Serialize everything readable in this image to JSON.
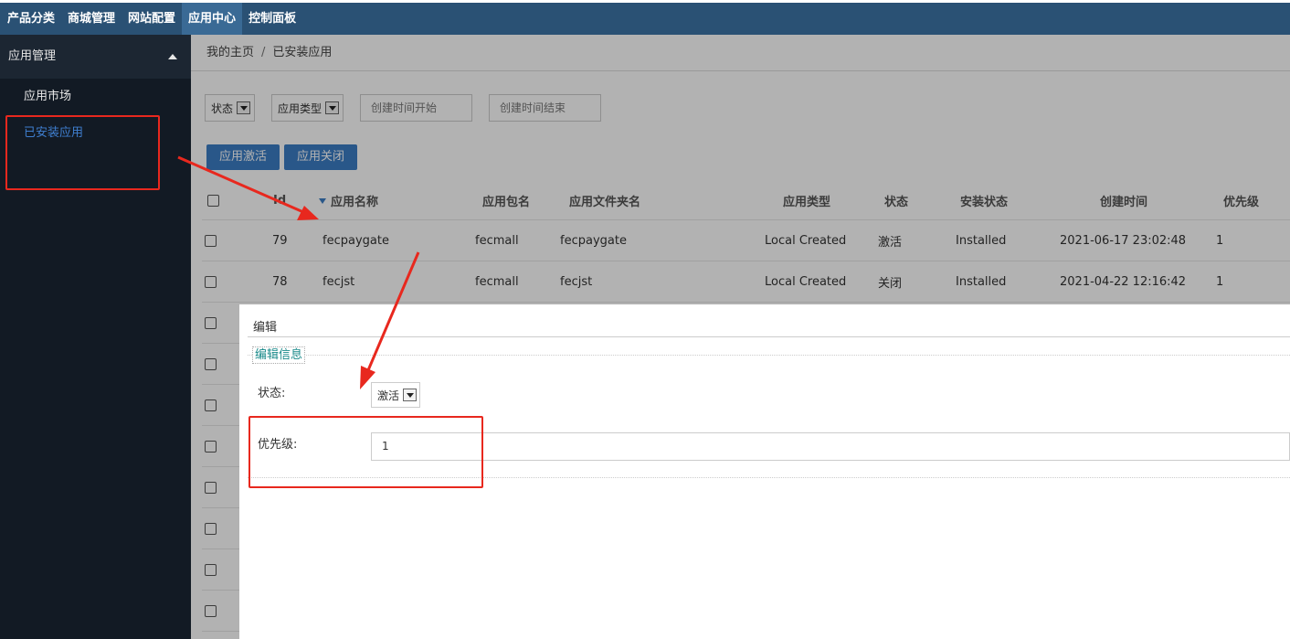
{
  "topnav": {
    "items": [
      {
        "label": "产品分类",
        "active": false
      },
      {
        "label": "商城管理",
        "active": false
      },
      {
        "label": "网站配置",
        "active": false
      },
      {
        "label": "应用中心",
        "active": true
      },
      {
        "label": "控制面板",
        "active": false
      }
    ]
  },
  "sidebar": {
    "group_title": "应用管理",
    "items": [
      {
        "label": "应用市场",
        "active": false
      },
      {
        "label": "已安装应用",
        "active": true
      }
    ]
  },
  "breadcrumb": {
    "home": "我的主页",
    "separator": "/",
    "current": "已安装应用"
  },
  "filters": {
    "status": "状态",
    "app_type": "应用类型",
    "created_start_placeholder": "创建时间开始",
    "created_end_placeholder": "创建时间结束"
  },
  "buttons": {
    "activate": "应用激活",
    "close": "应用关闭"
  },
  "table": {
    "columns": [
      "Id",
      "应用名称",
      "应用包名",
      "应用文件夹名",
      "应用类型",
      "状态",
      "安装状态",
      "创建时间",
      "优先级"
    ],
    "rows": [
      {
        "id": "79",
        "name": "fecpaygate",
        "package": "fecmall",
        "folder": "fecpaygate",
        "type": "Local Created",
        "status": "激活",
        "install": "Installed",
        "created": "2021-06-17 23:02:48",
        "priority": "1"
      },
      {
        "id": "78",
        "name": "fecjst",
        "package": "fecmall",
        "folder": "fecjst",
        "type": "Local Created",
        "status": "关闭",
        "install": "Installed",
        "created": "2021-04-22 12:16:42",
        "priority": "1"
      }
    ],
    "hidden_rows": 8
  },
  "dialog": {
    "title": "编辑",
    "legend": "编辑信息",
    "status_label": "状态:",
    "status_value": "激活",
    "priority_label": "优先级:",
    "priority_value": "1"
  },
  "colors": {
    "topnav_bg": "#2a5174",
    "sidebar_bg": "#121a24",
    "accent": "#3c7dc4",
    "annotation_red": "#e8281e"
  }
}
